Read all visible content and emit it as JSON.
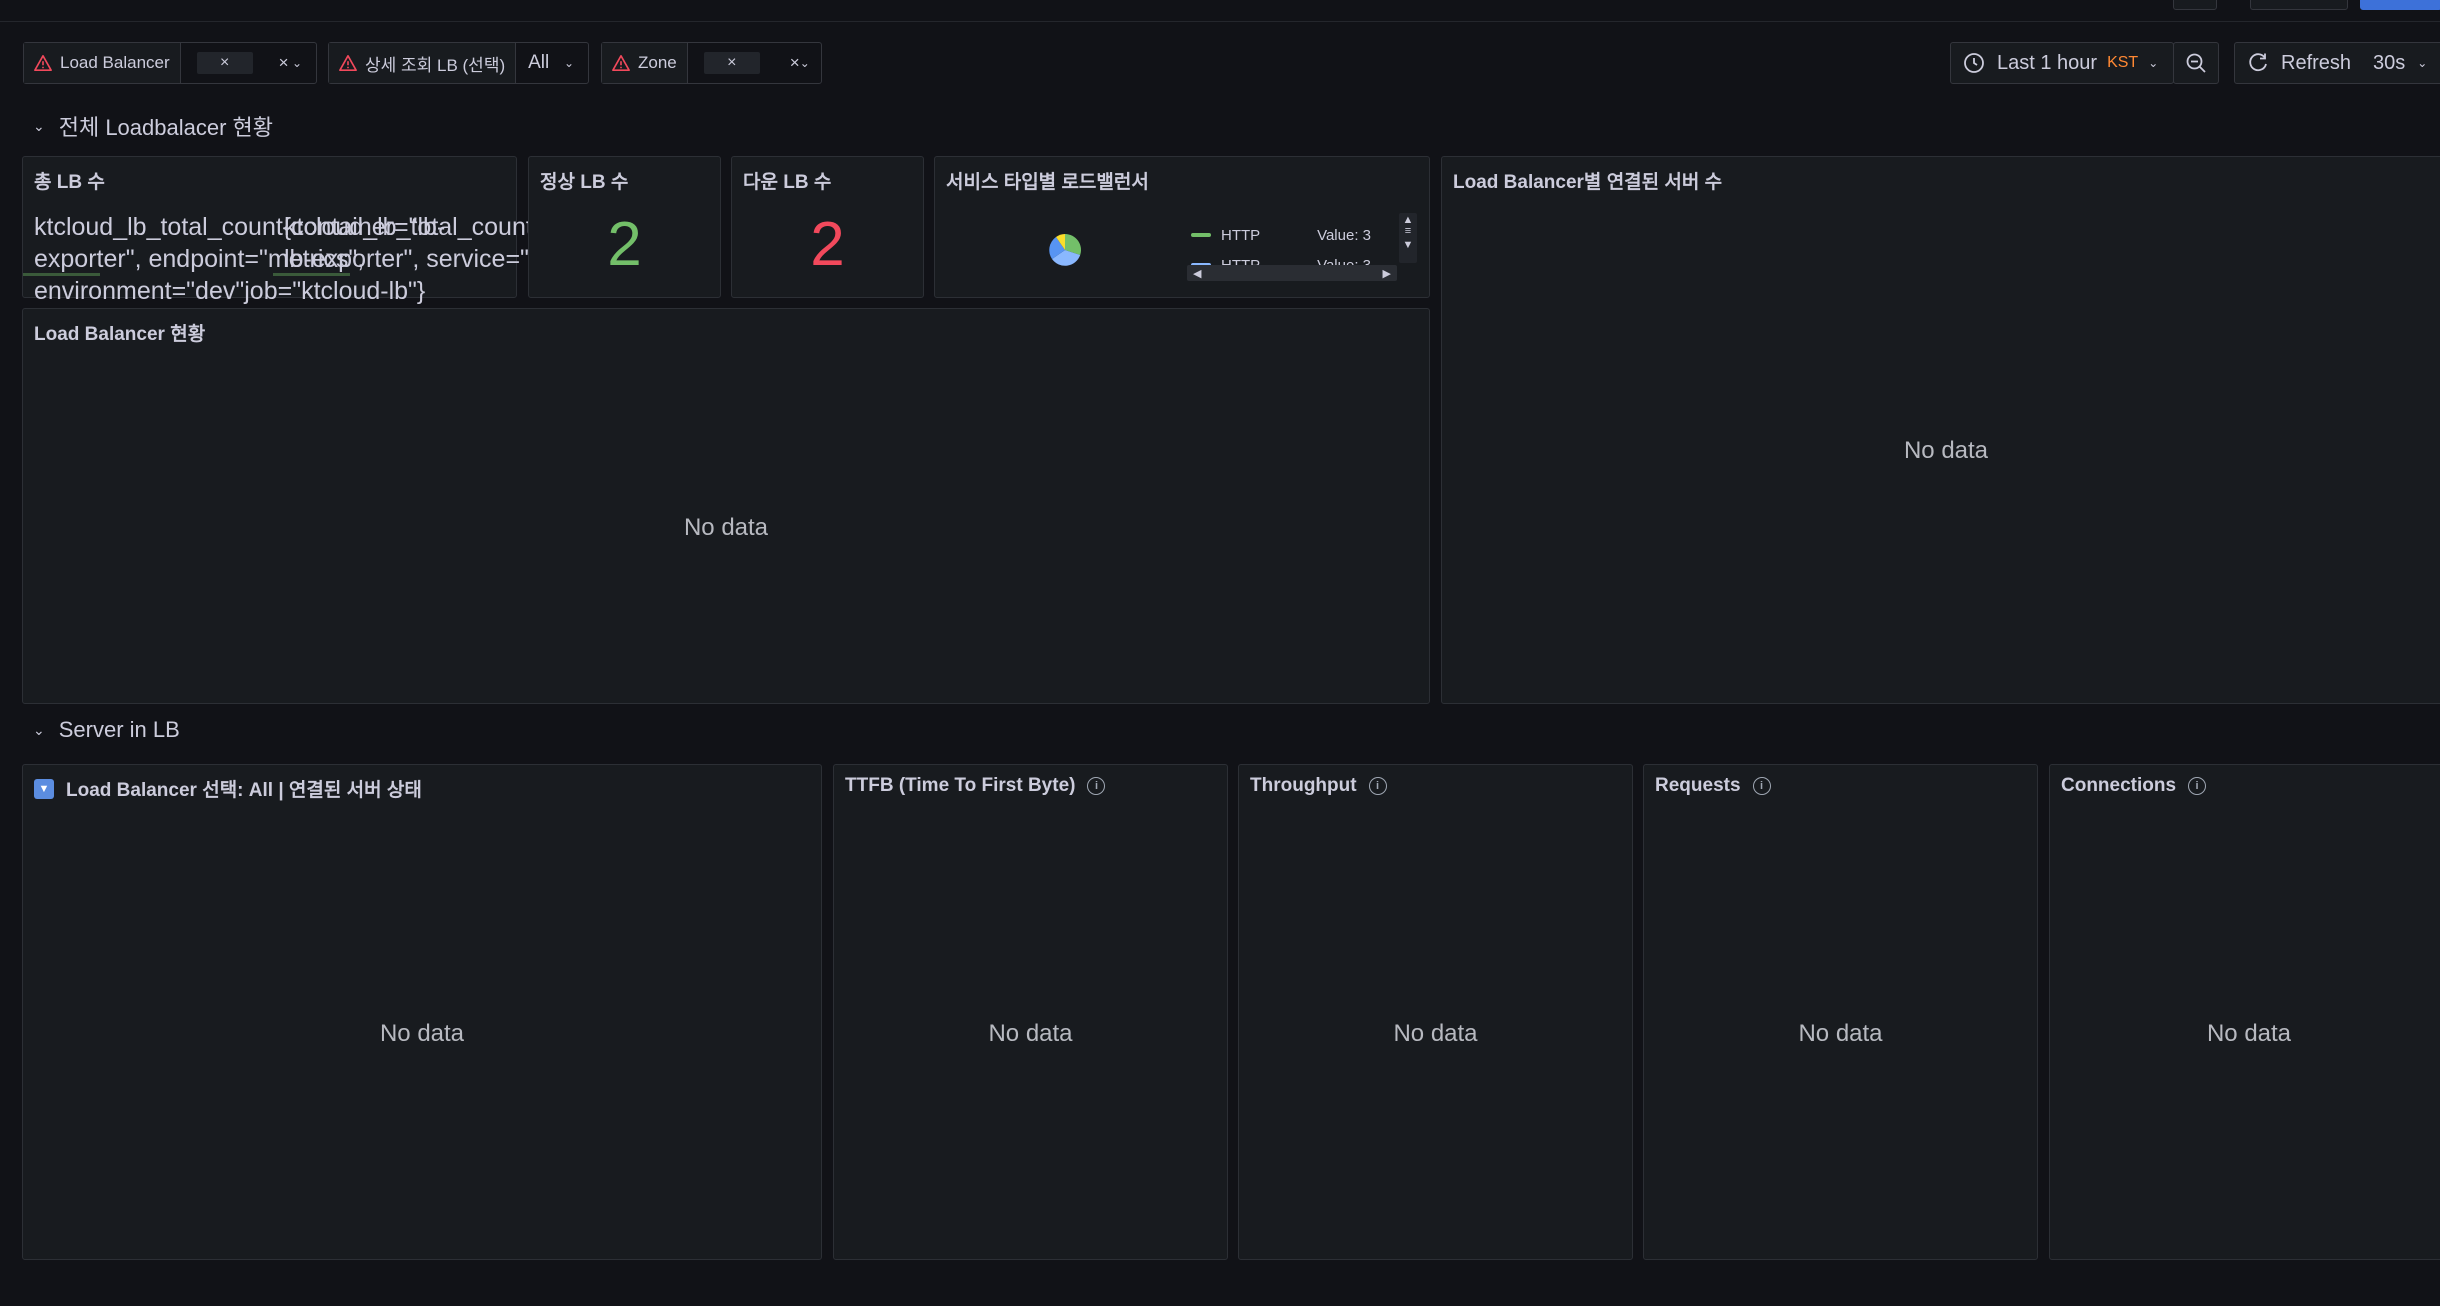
{
  "variables": [
    {
      "label": "Load Balancer",
      "chip": "×"
    },
    {
      "label": "상세 조회 LB (선택)",
      "value": "All"
    },
    {
      "label": "Zone",
      "chip": "×"
    }
  ],
  "time": {
    "range": "Last 1 hour",
    "tz": "KST",
    "refresh": "Refresh",
    "interval": "30s"
  },
  "rows": [
    {
      "title": "전체 Loadbalacer 현황"
    },
    {
      "title": "Server in LB"
    }
  ],
  "panels": {
    "total_lb": {
      "title": "총 LB 수",
      "line1a": "ktcloud_lb_total_count{container=\"lb-",
      "line1b": "ktcloud_lb_total_count{container=\"lb-",
      "line2a": "exporter\", endpoint=\"metrics\",",
      "line2b": "lb-exporter\", service=\"monitor",
      "line3": "environment=\"dev\"job=\"ktcloud-lb\"}"
    },
    "normal_lb": {
      "title": "정상 LB 수",
      "value": "2",
      "color": "#73bf69"
    },
    "down_lb": {
      "title": "다운 LB 수",
      "value": "2",
      "color": "#f2495c"
    },
    "service_type": {
      "title": "서비스 타입별 로드밸런서",
      "legend": [
        {
          "name": "HTTP",
          "value": "Value: 3",
          "color": "#73bf69"
        },
        {
          "name": "HTTP",
          "value": "Value: 3",
          "color": "#8ab8ff"
        }
      ]
    },
    "lb_servers": {
      "title": "Load Balancer별 연결된 서버 수",
      "nodata": "No data"
    },
    "lb_status": {
      "title": "Load Balancer 현황",
      "nodata": "No data"
    },
    "server_status": {
      "title": "Load Balancer 선택: All | 연결된 서버 상태",
      "nodata": "No data"
    },
    "ttfb": {
      "title": "TTFB (Time To First Byte)",
      "nodata": "No data"
    },
    "throughput": {
      "title": "Throughput",
      "nodata": "No data"
    },
    "requests": {
      "title": "Requests",
      "nodata": "No data"
    },
    "connections": {
      "title": "Connections",
      "nodata": "No data"
    }
  }
}
